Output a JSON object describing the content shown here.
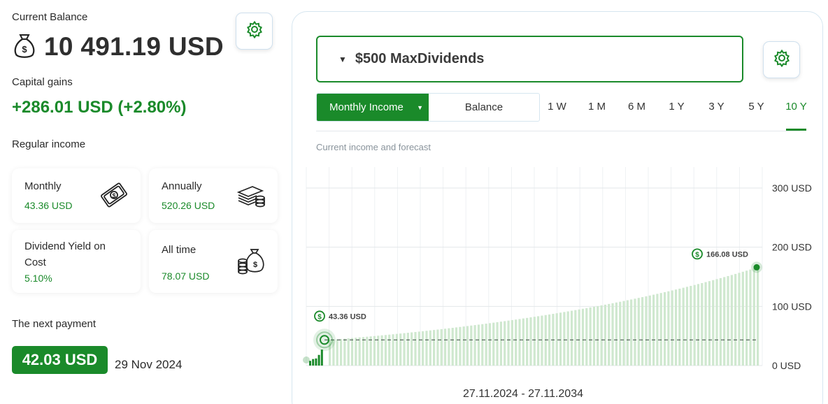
{
  "balance": {
    "label": "Current Balance",
    "value": "10 491.19 USD"
  },
  "capital_gains": {
    "label": "Capital gains",
    "value": "+286.01 USD (+2.80%)"
  },
  "regular_income": {
    "label": "Regular income",
    "cards": [
      {
        "label": "Monthly",
        "value": "43.36 USD",
        "icon": "banknote-icon"
      },
      {
        "label": "Annually",
        "value": "520.26 USD",
        "icon": "money-stack-icon"
      },
      {
        "label": "Dividend Yield on Cost",
        "value": "5.10%",
        "icon": null
      },
      {
        "label": "All time",
        "value": "78.07 USD",
        "icon": "money-bag-icon"
      }
    ]
  },
  "next_payment": {
    "label": "The next payment",
    "amount": "42.03 USD",
    "date": "29 Nov 2024"
  },
  "portfolio": {
    "selected": "$500 MaxDividends"
  },
  "chart_mode": {
    "active": "Monthly Income",
    "inactive": "Balance"
  },
  "periods": [
    "1 W",
    "1 M",
    "6 M",
    "1 Y",
    "3 Y",
    "5 Y",
    "10 Y"
  ],
  "active_period": "10 Y",
  "colors": {
    "accent": "#1a8a2a",
    "bar": "#cfe8cf",
    "bar_dark": "#1a8a2a"
  },
  "chart_data": {
    "type": "bar",
    "subtitle": "Current income and forecast",
    "y_ticks": [
      "0 USD",
      "100 USD",
      "200 USD",
      "300 USD"
    ],
    "ylim": [
      0,
      300
    ],
    "start_value": 43.36,
    "end_value": 166.08,
    "start_label": "43.36 USD",
    "end_label": "166.08 USD",
    "reference_value": 43.36,
    "historical_values": [
      8,
      11,
      12,
      18,
      27
    ],
    "forecast_count": 116,
    "range_label": "27.11.2024 - 27.11.2034",
    "grid": true
  }
}
